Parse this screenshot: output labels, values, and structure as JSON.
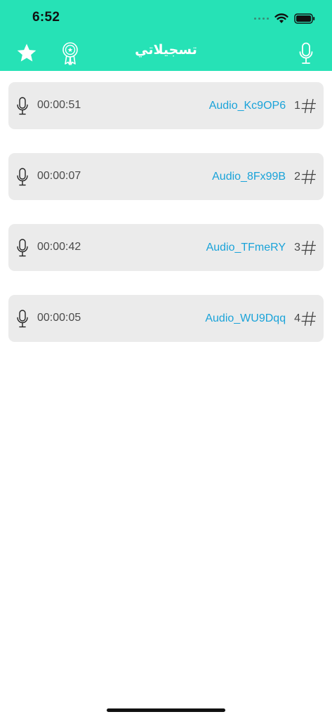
{
  "status_bar": {
    "time": "6:52"
  },
  "nav": {
    "title": "تسجيلاتي",
    "icons": [
      "star-icon",
      "award-badge-icon",
      "microphone-icon"
    ]
  },
  "colors": {
    "header": "#26e2b6",
    "row_background": "#ebebeb",
    "link": "#1aa3d9",
    "text": "#4a4a4a"
  },
  "recordings": [
    {
      "duration": "00:00:51",
      "name": "Audio_Kc9OP6",
      "index": "1"
    },
    {
      "duration": "00:00:07",
      "name": "Audio_8Fx99B",
      "index": "2"
    },
    {
      "duration": "00:00:42",
      "name": "Audio_TFmeRY",
      "index": "3"
    },
    {
      "duration": "00:00:05",
      "name": "Audio_WU9Dqq",
      "index": "4"
    }
  ]
}
